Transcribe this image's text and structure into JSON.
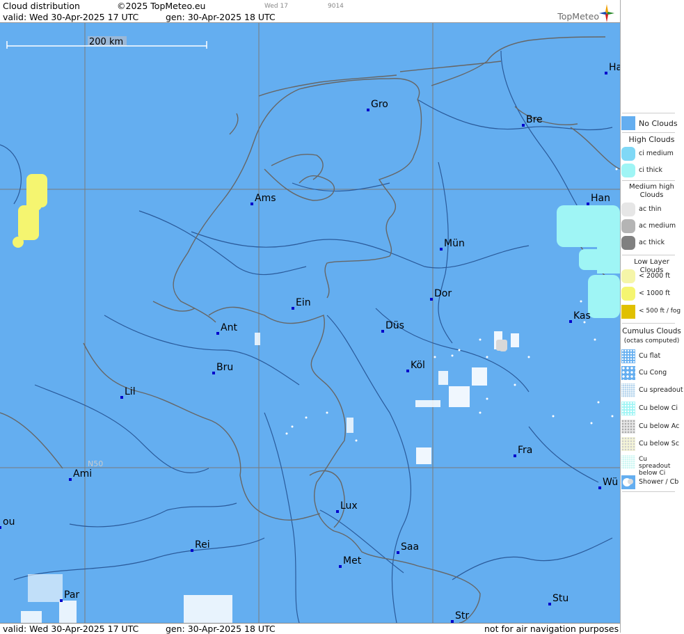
{
  "header": {
    "title": "Cloud distribution",
    "copyright": "©2025 TopMeteo.eu",
    "code_day": "Wed 17",
    "code_num": "9014",
    "valid": "valid:  Wed  30-Apr-2025  17 UTC",
    "gen": "gen: 30-Apr-2025 18 UTC",
    "brand": "TopMeteo"
  },
  "map": {
    "scale_label": "200 km",
    "lat_label": "N50",
    "cities": [
      {
        "name": "Gro"
      },
      {
        "name": "Ha"
      },
      {
        "name": "Bre"
      },
      {
        "name": "Ams"
      },
      {
        "name": "Han"
      },
      {
        "name": "Mün"
      },
      {
        "name": "Ein"
      },
      {
        "name": "Dor"
      },
      {
        "name": "Ant"
      },
      {
        "name": "Düs"
      },
      {
        "name": "Kas"
      },
      {
        "name": "Bru"
      },
      {
        "name": "Köl"
      },
      {
        "name": "Lil"
      },
      {
        "name": "Fra"
      },
      {
        "name": "Ami"
      },
      {
        "name": "Wü"
      },
      {
        "name": "Lux"
      },
      {
        "name": "ou"
      },
      {
        "name": "Rei"
      },
      {
        "name": "Saa"
      },
      {
        "name": "Met"
      },
      {
        "name": "Par"
      },
      {
        "name": "Stu"
      },
      {
        "name": "Str"
      }
    ]
  },
  "footer": {
    "valid": "valid:  Wed  30-Apr-2025  17 UTC",
    "gen": "gen: 30-Apr-2025 18 UTC",
    "disclaimer": "not for air navigation purposes"
  },
  "legend": {
    "no_clouds": "No Clouds",
    "high_title": "High Clouds",
    "ci_medium": "ci medium",
    "ci_thick": "ci thick",
    "medium_title": "Medium high Clouds",
    "ac_thin": "ac thin",
    "ac_medium": "ac medium",
    "ac_thick": "ac thick",
    "low_title": "Low Layer Clouds",
    "low_2000": "< 2000 ft",
    "low_1000": "< 1000 ft",
    "low_500": "< 500 ft / fog",
    "cumulus_title": "Cumulus Clouds",
    "cumulus_sub": "(octas computed)",
    "cu_flat": "Cu flat",
    "cu_cong": "Cu Cong",
    "cu_spreadout": "Cu spreadout",
    "cu_below_ci": "Cu below Ci",
    "cu_below_ac": "Cu below Ac",
    "cu_below_sc": "Cu below Sc",
    "cu_spreadout_below_ci": "Cu spreadout below Ci",
    "shower": "Shower / Cb"
  },
  "colors": {
    "no_clouds": "#64aef0",
    "ci_medium": "#7fd8f6",
    "ci_thick": "#9ff5f5",
    "ac_thin": "#e6e6e6",
    "ac_medium": "#b4b4b4",
    "ac_thick": "#808080",
    "low_2000": "#f5f5a8",
    "low_1000": "#f5f570",
    "low_500": "#e0c000",
    "border": "#555",
    "river": "#2a5a9a",
    "city_marker": "#0000cc"
  }
}
